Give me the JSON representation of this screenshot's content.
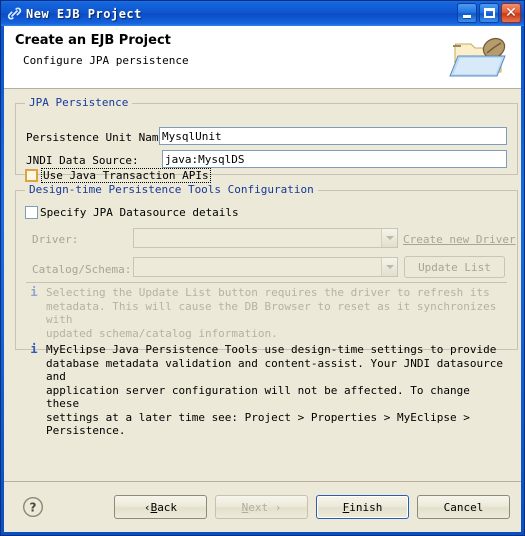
{
  "window": {
    "title": "New EJB Project",
    "icon": "link-icon",
    "buttons": {
      "minimize": {
        "name": "minimize-button",
        "glyph": "_"
      },
      "maximize": {
        "name": "maximize-button",
        "glyph": "□"
      },
      "close": {
        "name": "close-button",
        "glyph": "✕"
      }
    }
  },
  "header": {
    "title": "Create an EJB Project",
    "subtitle": "Configure JPA persistence",
    "icon": "java-folder-icon"
  },
  "jpa_persistence": {
    "group_title": "JPA Persistence",
    "persistence_unit": {
      "label": "Persistence Unit Name:",
      "value": "MysqlUnit",
      "placeholder": ""
    },
    "jndi_data_source": {
      "label": "JNDI Data Source:",
      "value": "java:MysqlDS",
      "placeholder": ""
    },
    "use_jta": {
      "label": "Use Java Transaction APIs",
      "checked": false,
      "focused": true
    }
  },
  "design_time": {
    "group_title": "Design-time Persistence Tools Configuration",
    "specify_jpa": {
      "label": "Specify JPA Datasource details",
      "checked": false
    },
    "driver": {
      "label": "Driver:",
      "value": "",
      "enabled": false
    },
    "create_new_driver": {
      "label": "Create new Driver",
      "enabled": false
    },
    "catalog_schema": {
      "label": "Catalog/Schema:",
      "value": "",
      "enabled": false
    },
    "update_list": {
      "label": "Update List",
      "enabled": false
    },
    "note": {
      "icon": "info-icon",
      "text": "Selecting the Update List button requires the driver to refresh its\nmetadata. This will cause the DB Browser to reset as it synchronizes with\nupdated schema/catalog information."
    }
  },
  "info_note": {
    "icon": "info-icon",
    "text": "MyEclipse Java Persistence Tools use design-time settings to provide\ndatabase metadata validation and content-assist. Your JNDI datasource and\napplication server configuration will not be affected. To change these\nsettings at a later time see: Project > Properties > MyEclipse >\nPersistence."
  },
  "footer": {
    "help": {
      "name": "help-button",
      "glyph": "?"
    },
    "back": {
      "prefix": "‹ ",
      "mnemonic": "B",
      "rest": "ack",
      "enabled": true
    },
    "next": {
      "prefix": "",
      "mnemonic": "N",
      "rest": "ext ›",
      "enabled": false
    },
    "finish": {
      "prefix": "",
      "mnemonic": "F",
      "rest": "inish",
      "enabled": true,
      "default": true
    },
    "cancel": {
      "prefix": "",
      "mnemonic": "",
      "rest": "Cancel",
      "enabled": true
    }
  },
  "colors": {
    "titlebar": "#0B52C8",
    "dialog_bg": "#ECE9D8",
    "group_title": "#15399B",
    "info_icon": "#2E5CB8",
    "disabled_text": "#A9A495",
    "field_border": "#7F9DB9"
  }
}
